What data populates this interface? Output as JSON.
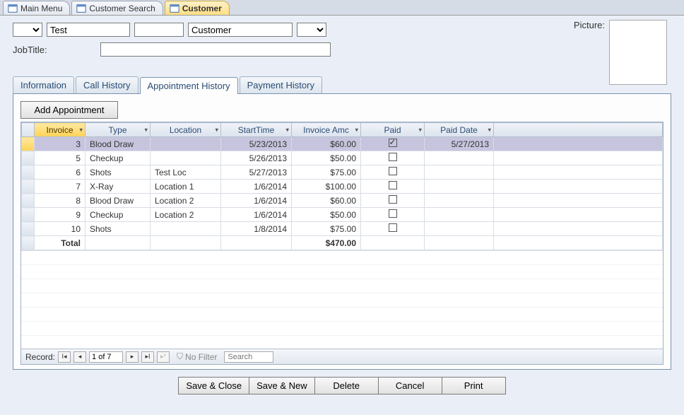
{
  "docTabs": [
    {
      "label": "Main Menu",
      "active": false
    },
    {
      "label": "Customer Search",
      "active": false
    },
    {
      "label": "Customer",
      "active": true
    }
  ],
  "header": {
    "firstName": "Test",
    "midBlank": "",
    "lastName": "Customer",
    "suffix": "",
    "jobTitleLabel": "JobTitle:",
    "jobTitle": "",
    "pictureLabel": "Picture:"
  },
  "subtabs": {
    "info": "Information",
    "call": "Call History",
    "appt": "Appointment History",
    "pay": "Payment History",
    "active": "appt"
  },
  "appt": {
    "addBtn": "Add Appointment",
    "cols": {
      "invoice": "Invoice",
      "type": "Type",
      "location": "Location",
      "start": "StartTime",
      "amount": "Invoice Amc",
      "paid": "Paid",
      "paidDate": "Paid Date"
    },
    "rows": [
      {
        "invoice": "3",
        "type": "Blood Draw",
        "location": "",
        "start": "5/23/2013",
        "amount": "$60.00",
        "paid": true,
        "paidDate": "5/27/2013",
        "selected": true
      },
      {
        "invoice": "5",
        "type": "Checkup",
        "location": "",
        "start": "5/26/2013",
        "amount": "$50.00",
        "paid": false,
        "paidDate": ""
      },
      {
        "invoice": "6",
        "type": "Shots",
        "location": "Test Loc",
        "start": "5/27/2013",
        "amount": "$75.00",
        "paid": false,
        "paidDate": ""
      },
      {
        "invoice": "7",
        "type": "X-Ray",
        "location": "Location 1",
        "start": "1/6/2014",
        "amount": "$100.00",
        "paid": false,
        "paidDate": ""
      },
      {
        "invoice": "8",
        "type": "Blood Draw",
        "location": "Location 2",
        "start": "1/6/2014",
        "amount": "$60.00",
        "paid": false,
        "paidDate": ""
      },
      {
        "invoice": "9",
        "type": "Checkup",
        "location": "Location 2",
        "start": "1/6/2014",
        "amount": "$50.00",
        "paid": false,
        "paidDate": ""
      },
      {
        "invoice": "10",
        "type": "Shots",
        "location": "",
        "start": "1/8/2014",
        "amount": "$75.00",
        "paid": false,
        "paidDate": ""
      }
    ],
    "totalLabel": "Total",
    "totalAmount": "$470.00"
  },
  "recnav": {
    "label": "Record:",
    "pos": "1 of 7",
    "nofilter": "No Filter",
    "searchPlaceholder": "Search"
  },
  "bottom": {
    "saveClose": "Save & Close",
    "saveNew": "Save & New",
    "delete": "Delete",
    "cancel": "Cancel",
    "print": "Print"
  }
}
